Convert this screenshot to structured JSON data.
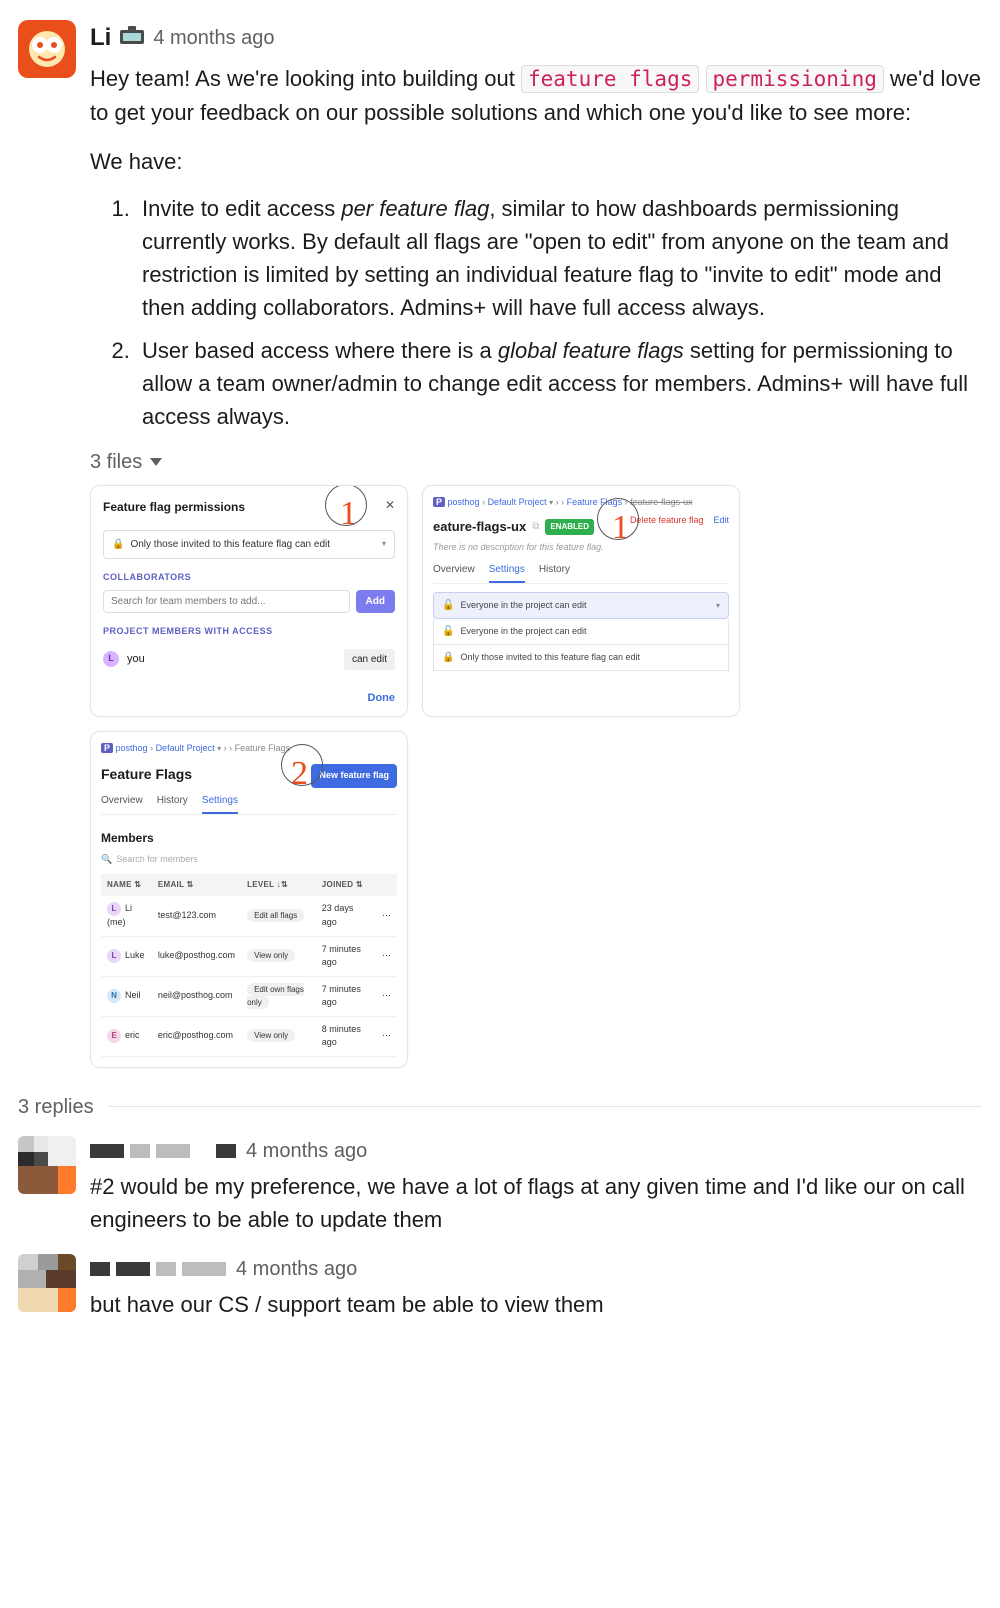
{
  "mainMessage": {
    "author": "Li",
    "timestamp": "4 months ago",
    "greeting": "Hey team! As we're looking into building out ",
    "codeChip1": "feature flags",
    "codeChip2": "permissioning",
    "midText": " we'd love to get your feedback on our possible solutions and which one you'd like to see more:",
    "weHave": "We have:",
    "opt1_a": "Invite to edit access ",
    "opt1_em": "per feature flag",
    "opt1_b": ", similar to how dashboards permissioning currently works. By default all flags are \"open to edit\" from anyone on the team and restriction is limited by setting an individual feature flag to \"invite to edit\" mode and then adding collaborators. Admins+ will have full access always.",
    "opt2_a": "User based access where there is a ",
    "opt2_em": "global feature flags",
    "opt2_b": " setting for permissioning to allow a team owner/admin to change edit access for members. Admins+ will have full access always.",
    "filesLabel": "3 files"
  },
  "thumb1": {
    "title": "Feature flag permissions",
    "num": "1",
    "selectText": "Only those invited to this feature flag can edit",
    "collab": "COLLABORATORS",
    "searchPlaceholder": "Search for team members to add...",
    "addBtn": "Add",
    "projMembers": "PROJECT MEMBERS WITH ACCESS",
    "memberInitial": "L",
    "memberName": "you",
    "canEdit": "can edit",
    "done": "Done"
  },
  "thumb2": {
    "crumb_ph": "posthog",
    "crumb_dp": "Default Project",
    "crumb_ff": "Feature Flags",
    "crumb_last": "feature-flags-ux",
    "title": "eature-flags-ux",
    "enabled": "ENABLED",
    "delete": "Delete feature flag",
    "edit": "Edit",
    "desc": "There is no description for this feature flag.",
    "num": "1",
    "tab_ov": "Overview",
    "tab_set": "Settings",
    "tab_hist": "History",
    "selOpt": "Everyone in the project can edit",
    "opt1": "Everyone in the project can edit",
    "opt2": "Only those invited to this feature flag can edit"
  },
  "thumb3": {
    "crumb_ph": "posthog",
    "crumb_dp": "Default Project",
    "crumb_ff": "Feature Flags",
    "title": "Feature Flags",
    "newBtn": "New feature flag",
    "num": "2",
    "tab_ov": "Overview",
    "tab_hist": "History",
    "tab_set": "Settings",
    "members": "Members",
    "searchPh": "Search for members",
    "th_name": "NAME",
    "th_email": "EMAIL",
    "th_level": "LEVEL",
    "th_joined": "JOINED",
    "rows": [
      {
        "i": "L",
        "cls": "av-l",
        "name": "Li (me)",
        "email": "test@123.com",
        "level": "Edit all flags",
        "joined": "23 days ago"
      },
      {
        "i": "L",
        "cls": "av-l",
        "name": "Luke",
        "email": "luke@posthog.com",
        "level": "View only",
        "joined": "7 minutes ago"
      },
      {
        "i": "N",
        "cls": "av-n",
        "name": "Neil",
        "email": "neil@posthog.com",
        "level": "Edit own flags only",
        "joined": "7 minutes ago"
      },
      {
        "i": "E",
        "cls": "av-e",
        "name": "eric",
        "email": "eric@posthog.com",
        "level": "View only",
        "joined": "8 minutes ago"
      }
    ]
  },
  "repliesHeader": "3 replies",
  "reply1": {
    "timestamp": "4 months ago",
    "text": "#2 would be my preference, we have a lot of flags at any given time and I'd like our on call engineers to be able to update them"
  },
  "reply2": {
    "timestamp": "4 months ago",
    "text": "but have our CS / support team be able to view them"
  }
}
